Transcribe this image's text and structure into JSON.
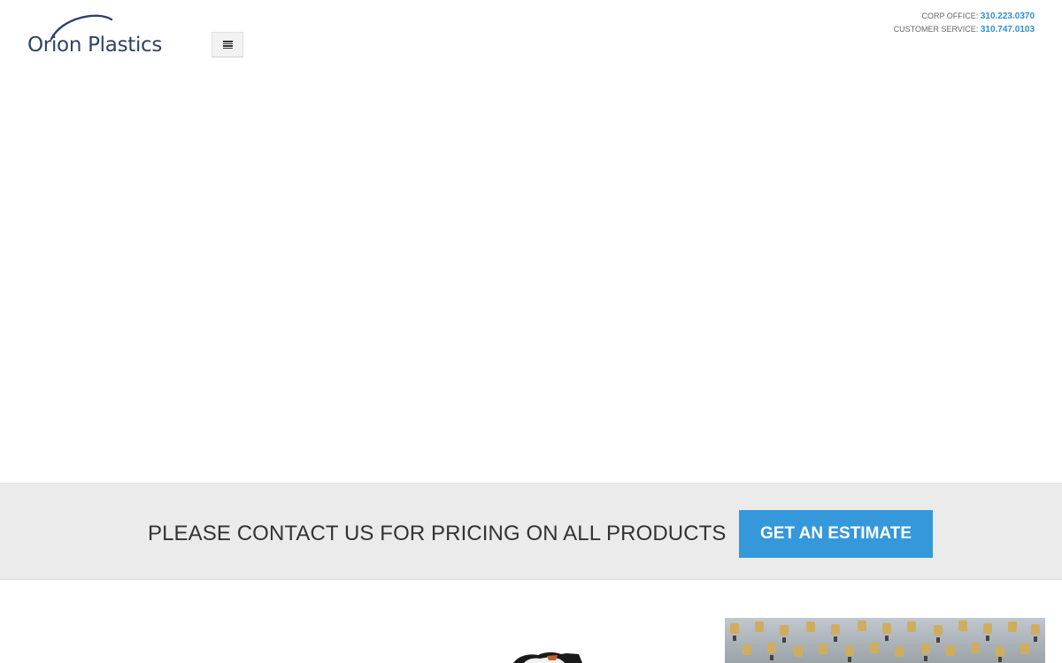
{
  "header": {
    "logo_text": "Orion Plastics",
    "menu_toggle_icon": "hamburger-icon",
    "contact": {
      "corp_label": "CORP OFFICE:",
      "corp_phone": "310.223.0370",
      "service_label": "CUSTOMER SERVICE:",
      "service_phone": "310.747.0103"
    }
  },
  "callout": {
    "text": "PLEASE CONTACT US FOR PRICING ON ALL PRODUCTS",
    "button_label": "GET AN ESTIMATE"
  },
  "colors": {
    "accent": "#3498db",
    "logo": "#2f4266",
    "callout_bg": "#ebebeb"
  }
}
